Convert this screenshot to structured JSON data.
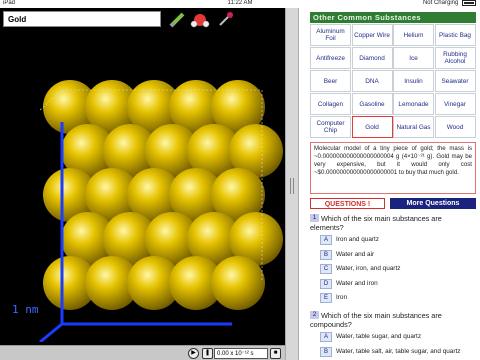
{
  "status_bar": {
    "device": "iPad",
    "time": "11:22 AM",
    "charging": "Not Charging"
  },
  "viewer": {
    "title_value": "Gold",
    "scale_label": "1 nm",
    "time_readout": "0.00 x 10⁻¹² s",
    "tools": [
      "pencil-icon",
      "molecule-icon",
      "pin-icon"
    ]
  },
  "substances": {
    "header": "Other Common Substances",
    "items": [
      "Aluminum Foil",
      "Copper Wire",
      "Helium",
      "Plastic Bag",
      "Antifreeze",
      "Diamond",
      "Ice",
      "Rubbing Alcohol",
      "Beer",
      "DNA",
      "Insulin",
      "Seawater",
      "Collagen",
      "Gasoline",
      "Lemonade",
      "Vinegar",
      "Computer Chip",
      "Gold",
      "Natural Gas",
      "Wood"
    ],
    "selected": "Gold"
  },
  "description": "Molecular model of a tiny piece of gold; the mass is ~0.000000000000000000004 g (4×10⁻²¹ g). Gold may be very expensive, but it would only cost ~$0.000000000000000000001 to buy that much gold.",
  "buttons": {
    "questions": "QUESTIONS !",
    "more_questions": "More Questions"
  },
  "questions": [
    {
      "num": "1",
      "text": "Which of the six main substances are elements?",
      "options": [
        {
          "letter": "A",
          "text": "Iron and quartz"
        },
        {
          "letter": "B",
          "text": "Water and air"
        },
        {
          "letter": "C",
          "text": "Water, iron, and quartz"
        },
        {
          "letter": "D",
          "text": "Water and iron"
        },
        {
          "letter": "E",
          "text": "Iron"
        }
      ]
    },
    {
      "num": "2",
      "text": "Which of the six main substances are compounds?",
      "options": [
        {
          "letter": "A",
          "text": "Water, table sugar, and quartz"
        },
        {
          "letter": "B",
          "text": "Water, table salt, air, table sugar, and quartz"
        }
      ]
    }
  ],
  "colors": {
    "gold": "#d4b200",
    "header_green": "#2e7d32",
    "axis_blue": "#1a3cff",
    "link_blue": "#1f2d8a"
  }
}
